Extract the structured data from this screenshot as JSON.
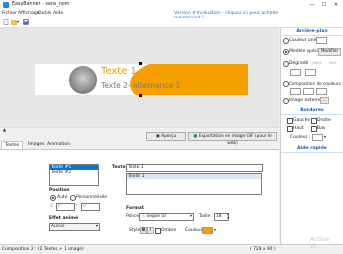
{
  "window": {
    "title": "EasyBanner - sans_nom",
    "min": "—",
    "max": "☐",
    "close": "✕"
  },
  "menu": [
    "Fichier",
    "Affichage",
    "Outils",
    "Aide"
  ],
  "eval_notice": "Version d'évaluation - cliquez ici pour acheter maintenant !",
  "banner": {
    "text1": "Texte 1",
    "text2": "Texte 2- alternance 1"
  },
  "actions": {
    "preview": "Aperçu",
    "export": "Exportation en image GIF (pour le web)"
  },
  "tabs": [
    "Textes",
    "Images",
    "Animation"
  ],
  "texts_list": [
    "Texte #1",
    "Texte #2"
  ],
  "position": {
    "label": "Position",
    "auto": "Auto",
    "custom": "Personnalisée",
    "x_label": "X :",
    "x_value": "0",
    "y_label": "Y :",
    "y_value": "0"
  },
  "effect": {
    "label": "Effet animé",
    "value": "Aucun"
  },
  "text_field": {
    "label": "Texte :",
    "value": "Texte 1",
    "list_item": "Texte 1"
  },
  "format": {
    "label": "Format",
    "font_label": "Police :",
    "font_value": "Segoe UI",
    "size_label": "Taille :",
    "size_value": "18",
    "style_label": "Style :",
    "bold": "B",
    "italic": "I",
    "shadow_label": "Ombre",
    "color_label": "Couleur :"
  },
  "right_panel": {
    "background_header": "Arrière-plan",
    "uni_color": "Couleur unie",
    "special_model": "Modèle spécial",
    "modify": "Modifier",
    "gradient": "Dégradé",
    "gradient_h": "Horiz.",
    "gradient_v": "Vert.",
    "color_comp": "Composition de couleurs",
    "bg_image": "Image externe",
    "borders_header": "Bordures",
    "left": "Gauche",
    "right": "Droite",
    "top": "Haut",
    "bottom": "Bas",
    "border_color": "Couleur :",
    "quick_header": "Aide rapide"
  },
  "status": {
    "composition": "Composition 2 : (2 Textes + 1 image)",
    "size": "( 728 x 90 )",
    "watermark": "Activer W..."
  },
  "colors": {
    "accent_orange": "#f6a000",
    "text_orange": "#f29b00",
    "link_blue": "#1e74d6"
  }
}
